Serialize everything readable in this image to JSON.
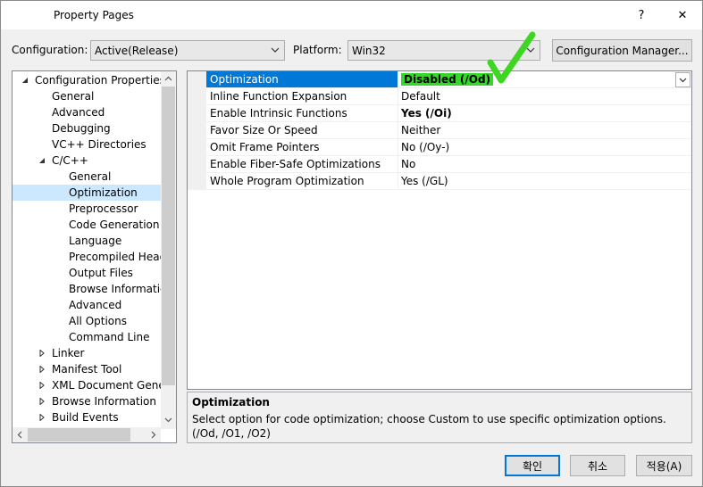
{
  "window": {
    "title": "Property Pages",
    "help_glyph": "?",
    "close_glyph": "✕"
  },
  "config_bar": {
    "configuration_label": "Configuration:",
    "configuration_value": "Active(Release)",
    "platform_label": "Platform:",
    "platform_value": "Win32",
    "config_manager_label": "Configuration Manager..."
  },
  "tree": {
    "items": [
      {
        "label": "Configuration Properties",
        "expander": "expanded"
      },
      {
        "label": "General"
      },
      {
        "label": "Advanced"
      },
      {
        "label": "Debugging"
      },
      {
        "label": "VC++ Directories"
      },
      {
        "label": "C/C++",
        "expander": "expanded"
      },
      {
        "label": "General"
      },
      {
        "label": "Optimization",
        "selected": true
      },
      {
        "label": "Preprocessor"
      },
      {
        "label": "Code Generation"
      },
      {
        "label": "Language"
      },
      {
        "label": "Precompiled Heade"
      },
      {
        "label": "Output Files"
      },
      {
        "label": "Browse Information"
      },
      {
        "label": "Advanced"
      },
      {
        "label": "All Options"
      },
      {
        "label": "Command Line"
      },
      {
        "label": "Linker",
        "expander": "collapsed"
      },
      {
        "label": "Manifest Tool",
        "expander": "collapsed"
      },
      {
        "label": "XML Document Genera",
        "expander": "collapsed"
      },
      {
        "label": "Browse Information",
        "expander": "collapsed"
      },
      {
        "label": "Build Events",
        "expander": "collapsed"
      }
    ]
  },
  "grid": {
    "rows": [
      {
        "name": "Optimization",
        "value": "Disabled (/Od)",
        "selected": true,
        "highlight": true
      },
      {
        "name": "Inline Function Expansion",
        "value": "Default"
      },
      {
        "name": "Enable Intrinsic Functions",
        "value": "Yes (/Oi)",
        "bold": true
      },
      {
        "name": "Favor Size Or Speed",
        "value": "Neither"
      },
      {
        "name": "Omit Frame Pointers",
        "value": "No (/Oy-)"
      },
      {
        "name": "Enable Fiber-Safe Optimizations",
        "value": "No"
      },
      {
        "name": "Whole Program Optimization",
        "value": "Yes (/GL)"
      }
    ]
  },
  "description": {
    "title": "Optimization",
    "text": "Select option for code optimization; choose Custom to use specific optimization options.     (/Od, /O1, /O2)"
  },
  "buttons": {
    "ok": "확인",
    "cancel": "취소",
    "apply": "적용(A)"
  },
  "colors": {
    "selection_blue": "#0078d7",
    "tree_selection": "#cce8ff",
    "highlight_green": "#34d82a",
    "checkmark_green": "#3fd623"
  },
  "annotation": {
    "icon": "checkmark-icon"
  }
}
